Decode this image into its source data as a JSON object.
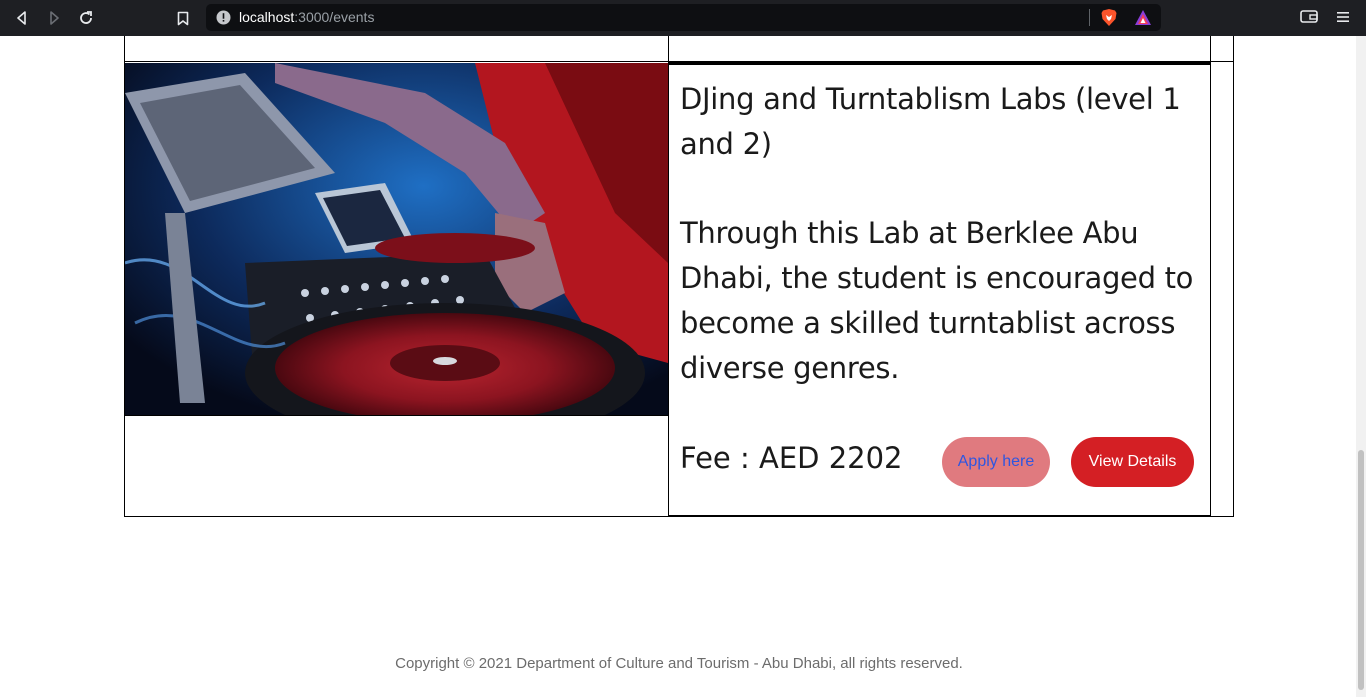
{
  "browser": {
    "url_host": "localhost",
    "url_path": ":3000/events"
  },
  "event": {
    "title": "DJing and Turntablism Labs (level 1 and 2)",
    "description": "Through this Lab at Berklee Abu Dhabi, the student is encouraged to become a skilled turntablist across diverse genres.",
    "fee": "Fee : AED 2202",
    "apply_label": "Apply here",
    "details_label": "View Details"
  },
  "footer": {
    "copyright": "Copyright © 2021 Department of Culture and Tourism - Abu Dhabi, all rights reserved."
  },
  "colors": {
    "apply_bg": "#e07a7f",
    "apply_text": "#2f56e0",
    "details_bg": "#d41f24"
  },
  "icons": {
    "back": "back-icon",
    "forward": "forward-icon",
    "reload": "reload-icon",
    "bookmark": "bookmark-icon",
    "site_info": "info-icon",
    "brave_shield": "brave-shield-icon",
    "rewards": "brave-rewards-icon",
    "wallet": "wallet-icon",
    "menu": "menu-icon"
  }
}
